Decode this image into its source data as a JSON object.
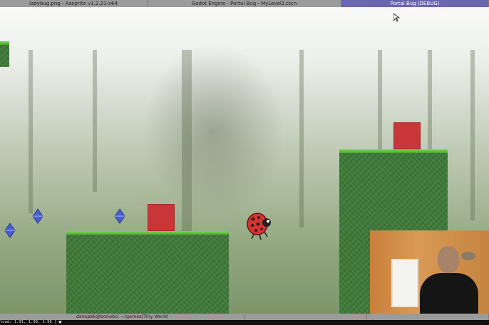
{
  "taskbar": {
    "tasks": [
      {
        "label": "ladybug.png - Aseprite v1.2.21-x64"
      },
      {
        "label": "Godot Engine - Portal Bug - MyLevel1.tscn"
      },
      {
        "label": "Portal Bug (DEBUG)"
      }
    ]
  },
  "bottombar": {
    "tasks": [
      {
        "label": "dsnopek@bonobo: ~/games/Tiny World"
      },
      {
        "label": ""
      },
      {
        "label": ""
      }
    ]
  },
  "terminal": {
    "text": "load: 1.91, 1.98, 1.96  ]                                                                                  ■"
  },
  "colors": {
    "grass": "#5fbf3c",
    "block": "#c8363a",
    "gem": "#4a5fcf",
    "active_task": "#6a66b4"
  },
  "icons": {
    "cursor": "mouse-cursor-icon",
    "gem": "diamond-gem-icon",
    "player": "ladybug-icon"
  }
}
